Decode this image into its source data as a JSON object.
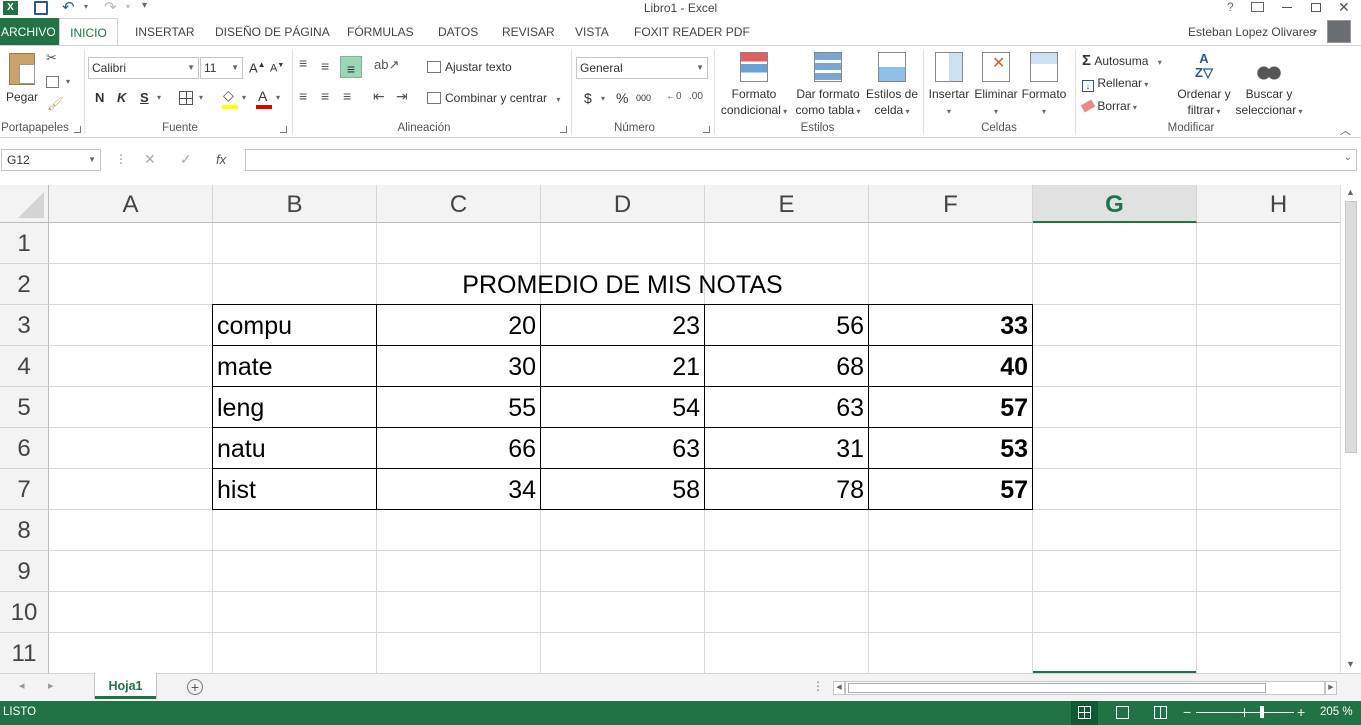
{
  "titlebar": {
    "title": "Libro1 - Excel",
    "help": "?"
  },
  "tabs": {
    "file": "ARCHIVO",
    "items": [
      "INICIO",
      "INSERTAR",
      "DISEÑO DE PÁGINA",
      "FÓRMULAS",
      "DATOS",
      "REVISAR",
      "VISTA",
      "FOXIT READER PDF"
    ],
    "user": "Esteban Lopez Olivares"
  },
  "ribbon": {
    "clipboard": {
      "paste": "Pegar",
      "label": "Portapapeles"
    },
    "font": {
      "name": "Calibri",
      "size": "11",
      "bold": "N",
      "italic": "K",
      "underline": "S",
      "label": "Fuente"
    },
    "alignment": {
      "wrap": "Ajustar texto",
      "merge": "Combinar y centrar",
      "label": "Alineación"
    },
    "number": {
      "format": "General",
      "currency": "$",
      "percent": "%",
      "thousands": "000",
      "label": "Número"
    },
    "styles": {
      "conditional_1": "Formato",
      "conditional_2": "condicional",
      "table_1": "Dar formato",
      "table_2": "como tabla",
      "cell_1": "Estilos de",
      "cell_2": "celda",
      "label": "Estilos"
    },
    "cells": {
      "insert": "Insertar",
      "delete": "Eliminar",
      "format": "Formato",
      "label": "Celdas"
    },
    "editing": {
      "autosum": "Autosuma",
      "fill": "Rellenar",
      "clear": "Borrar",
      "sort_1": "Ordenar y",
      "sort_2": "filtrar",
      "find_1": "Buscar y",
      "find_2": "seleccionar",
      "label": "Modificar"
    }
  },
  "formula_bar": {
    "name_box": "G12",
    "fx": "fx",
    "value": ""
  },
  "grid": {
    "columns": [
      "A",
      "B",
      "C",
      "D",
      "E",
      "F",
      "G",
      "H"
    ],
    "rows": [
      "1",
      "2",
      "3",
      "4",
      "5",
      "6",
      "7",
      "8",
      "9",
      "10",
      "11"
    ],
    "title": "PROMEDIO DE MIS NOTAS",
    "table": [
      {
        "subject": "compu",
        "c": "20",
        "d": "23",
        "e": "56",
        "f": "33"
      },
      {
        "subject": "mate",
        "c": "30",
        "d": "21",
        "e": "68",
        "f": "40"
      },
      {
        "subject": "leng",
        "c": "55",
        "d": "54",
        "e": "63",
        "f": "57"
      },
      {
        "subject": "natu",
        "c": "66",
        "d": "63",
        "e": "31",
        "f": "53"
      },
      {
        "subject": "hist",
        "c": "34",
        "d": "58",
        "e": "78",
        "f": "57"
      }
    ]
  },
  "sheets": {
    "active": "Hoja1"
  },
  "status": {
    "mode": "LISTO",
    "zoom": "205 %"
  },
  "colors": {
    "accent": "#217346"
  }
}
